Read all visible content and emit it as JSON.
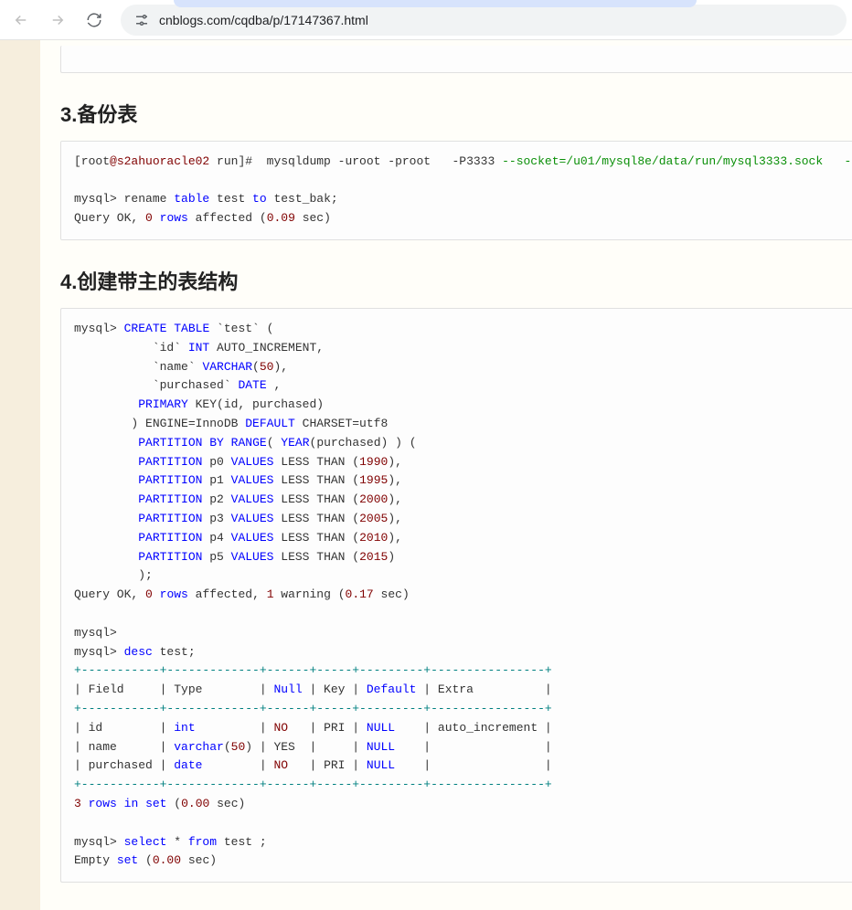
{
  "browser": {
    "url": "cnblogs.com/cqdba/p/17147367.html"
  },
  "headings": {
    "h3": "3.备份表",
    "h4": "4.创建带主的表结构"
  },
  "code_block_3": {
    "prompt": "[root",
    "host": "@s2ahuoracle02",
    "path": " run]#  mysqldump -uroot -proot   -P3333 ",
    "opt1": "--socket=/u01/mysql8e/data/run/mysql3333.sock",
    "opt2": "   --set-gtid",
    "line2_a": "mysql> rename ",
    "line2_kw": "table",
    "line2_b": " test ",
    "line2_kw2": "to",
    "line2_c": " test_bak;",
    "line3_a": "Query OK, ",
    "line3_n": "0",
    "line3_b": " ",
    "line3_kw": "rows",
    "line3_c": " affected (",
    "line3_n2": "0.09",
    "line3_d": " sec)"
  },
  "code_block_4": {
    "l01_a": "mysql> ",
    "l01_kw": "CREATE",
    "l01_b": " ",
    "l01_kw2": "TABLE",
    "l01_c": " `test` (",
    "l02_a": "           `id` ",
    "l02_kw": "INT",
    "l02_b": " AUTO_INCREMENT,",
    "l03_a": "           `name` ",
    "l03_kw": "VARCHAR",
    "l03_b": "(",
    "l03_n": "50",
    "l03_c": "),",
    "l04_a": "           `purchased` ",
    "l04_kw": "DATE",
    "l04_b": " ,",
    "l05_a": "         ",
    "l05_kw": "PRIMARY",
    "l05_b": " KEY(id, purchased)",
    "l06_a": "        ) ENGINE=InnoDB ",
    "l06_kw": "DEFAULT",
    "l06_b": " CHARSET=utf8",
    "l07_a": "         ",
    "l07_kw": "PARTITION",
    "l07_b": " ",
    "l07_kw2": "BY",
    "l07_c": " ",
    "l07_kw3": "RANGE",
    "l07_d": "( ",
    "l07_kw4": "YEAR",
    "l07_e": "(purchased) ) (",
    "l08_a": "         ",
    "l08_kw": "PARTITION",
    "l08_b": " p0 ",
    "l08_kw2": "VALUES",
    "l08_c": " LESS THAN (",
    "l08_n": "1990",
    "l08_d": "),",
    "l09_a": "         ",
    "l09_kw": "PARTITION",
    "l09_b": " p1 ",
    "l09_kw2": "VALUES",
    "l09_c": " LESS THAN (",
    "l09_n": "1995",
    "l09_d": "),",
    "l10_a": "         ",
    "l10_kw": "PARTITION",
    "l10_b": " p2 ",
    "l10_kw2": "VALUES",
    "l10_c": " LESS THAN (",
    "l10_n": "2000",
    "l10_d": "),",
    "l11_a": "         ",
    "l11_kw": "PARTITION",
    "l11_b": " p3 ",
    "l11_kw2": "VALUES",
    "l11_c": " LESS THAN (",
    "l11_n": "2005",
    "l11_d": "),",
    "l12_a": "         ",
    "l12_kw": "PARTITION",
    "l12_b": " p4 ",
    "l12_kw2": "VALUES",
    "l12_c": " LESS THAN (",
    "l12_n": "2010",
    "l12_d": "),",
    "l13_a": "         ",
    "l13_kw": "PARTITION",
    "l13_b": " p5 ",
    "l13_kw2": "VALUES",
    "l13_c": " LESS THAN (",
    "l13_n": "2015",
    "l13_d": ")",
    "l14": "         );",
    "l15_a": "Query OK, ",
    "l15_n1": "0",
    "l15_b": " ",
    "l15_kw": "rows",
    "l15_c": " affected, ",
    "l15_n2": "1",
    "l15_d": " warning (",
    "l15_n3": "0.17",
    "l15_e": " sec)",
    "l16": "",
    "l17": "mysql>",
    "l18_a": "mysql> ",
    "l18_kw": "desc",
    "l18_b": " test;",
    "border1": "+-----------+-------------+------+-----+---------+----------------+",
    "hdr": "| Field     | Type        | ",
    "hdr_null": "Null",
    "hdr_b": " | Key | ",
    "hdr_def": "Default",
    "hdr_c": " | Extra          |",
    "border2": "+-----------+-------------+------+-----+---------+----------------+",
    "row1_a": "| id        | ",
    "row1_t": "int",
    "row1_b": "         | ",
    "row1_no": "NO",
    "row1_c": "   | PRI | ",
    "row1_null": "NULL",
    "row1_d": "    | auto_increment |",
    "row2_a": "| name      | ",
    "row2_t": "varchar",
    "row2_b": "(",
    "row2_n": "50",
    "row2_c": ") | YES  |     | ",
    "row2_null": "NULL",
    "row2_d": "    |                |",
    "row3_a": "| purchased | ",
    "row3_t": "date",
    "row3_b": "        | ",
    "row3_no": "NO",
    "row3_c": "   | PRI | ",
    "row3_null": "NULL",
    "row3_d": "    |                |",
    "border3": "+-----------+-------------+------+-----+---------+----------------+",
    "l_rows_a": "",
    "l_rows_n": "3",
    "l_rows_b": " ",
    "l_rows_kw": "rows",
    "l_rows_c": " ",
    "l_rows_kw2": "in",
    "l_rows_d": " ",
    "l_rows_kw3": "set",
    "l_rows_e": " (",
    "l_rows_n2": "0.00",
    "l_rows_f": " sec)",
    "l_sel_a": "mysql> ",
    "l_sel_kw": "select",
    "l_sel_b": " * ",
    "l_sel_kw2": "from",
    "l_sel_c": " test ;",
    "l_emp_a": "Empty ",
    "l_emp_kw": "set",
    "l_emp_b": " (",
    "l_emp_n": "0.00",
    "l_emp_c": " sec)"
  }
}
